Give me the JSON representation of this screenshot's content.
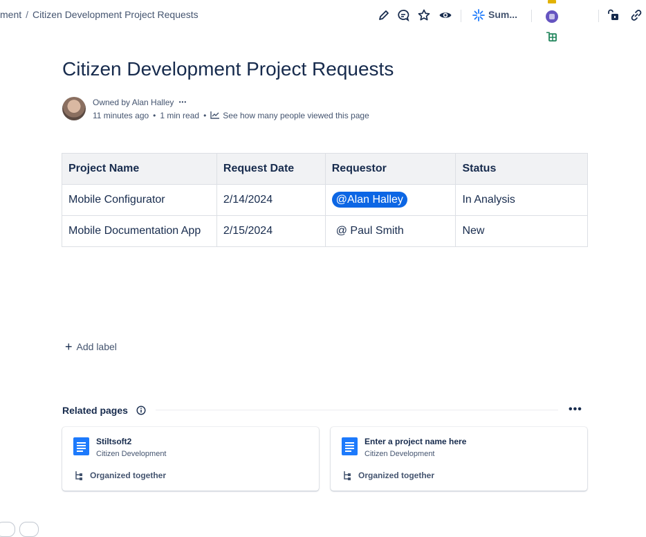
{
  "breadcrumb": {
    "parent": "ment",
    "current": "Citizen Development Project Requests"
  },
  "toolbar": {
    "summarize_label": "Sum..."
  },
  "page": {
    "title": "Citizen Development Project Requests"
  },
  "byline": {
    "owned_by": "Owned by Alan Halley",
    "more": "•••",
    "edited": "11 minutes ago",
    "read_time": "1 min read",
    "views_link": "See how many people viewed this page"
  },
  "table": {
    "headers": [
      "Project Name",
      "Request Date",
      "Requestor",
      "Status"
    ],
    "rows": [
      [
        "Mobile Configurator",
        "2/14/2024",
        "@Alan Halley",
        "In Analysis"
      ],
      [
        "Mobile Documentation App",
        "2/15/2024",
        "@ Paul Smith",
        "New"
      ]
    ]
  },
  "labels": {
    "add_label": "Add label"
  },
  "related": {
    "title": "Related pages",
    "more": "•••",
    "cards": [
      {
        "title": "Stiltsoft2",
        "space": "Citizen Development",
        "reason": "Organized together"
      },
      {
        "title": "Enter a project name here",
        "space": "Citizen Development",
        "reason": "Organized together"
      }
    ]
  },
  "colors": {
    "accent": "#0c66e4",
    "doc_icon": "#1d7afc",
    "text": "#172b4d",
    "subtle": "#44546f"
  }
}
